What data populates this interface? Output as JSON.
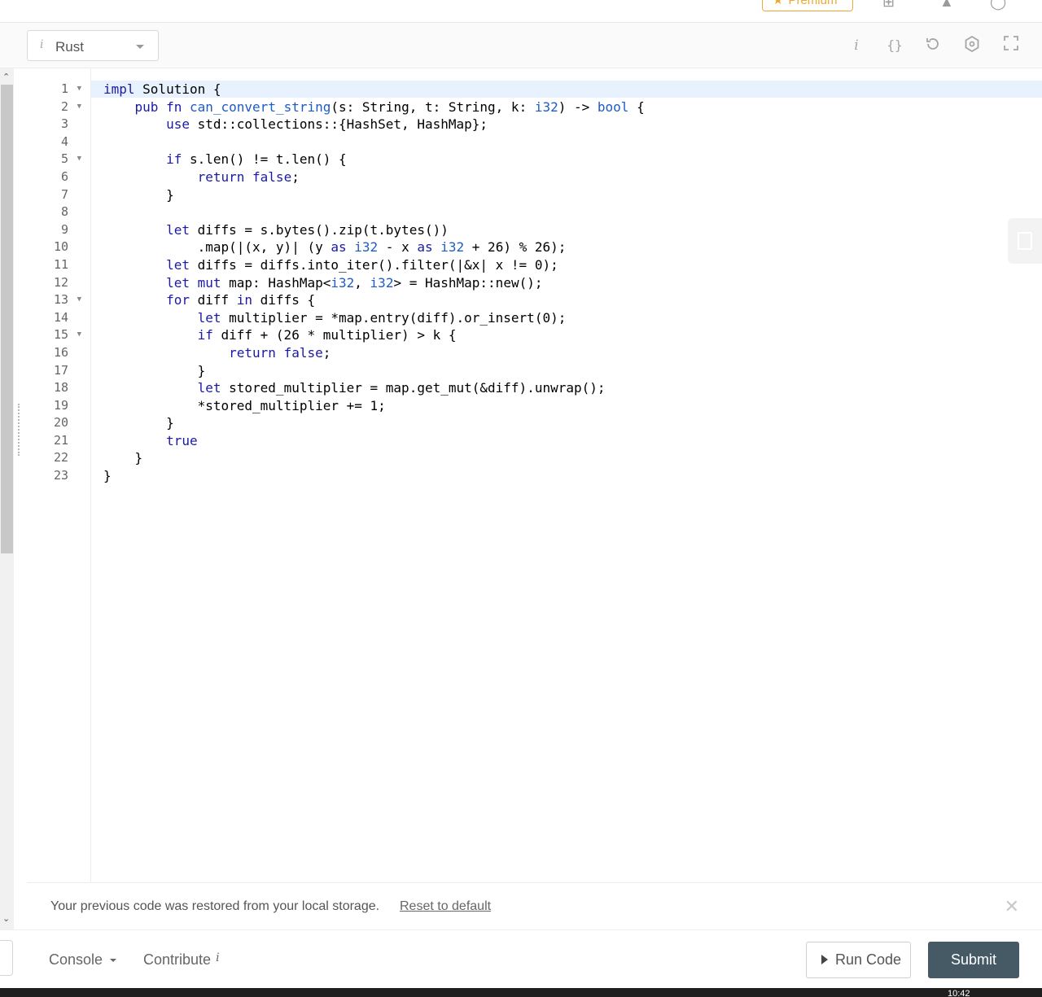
{
  "topbar": {
    "premium_label": "Premium",
    "icons": [
      "new-playground-icon",
      "bell-icon",
      "user-avatar-icon"
    ]
  },
  "toolbar": {
    "language": "Rust",
    "language_info": "i",
    "icons": [
      "info-icon",
      "braces-icon",
      "reset-icon",
      "settings-icon",
      "fullscreen-icon"
    ]
  },
  "editor": {
    "lines": [
      "impl Solution {",
      "    pub fn can_convert_string(s: String, t: String, k: i32) -> bool {",
      "        use std::collections::{HashSet, HashMap};",
      "",
      "        if s.len() != t.len() {",
      "            return false;",
      "        }",
      "",
      "        let diffs = s.bytes().zip(t.bytes())",
      "            .map(|(x, y)| (y as i32 - x as i32 + 26) % 26);",
      "        let diffs = diffs.into_iter().filter(|&x| x != 0);",
      "        let mut map: HashMap<i32, i32> = HashMap::new();",
      "        for diff in diffs {",
      "            let multiplier = *map.entry(diff).or_insert(0);",
      "            if diff + (26 * multiplier) > k {",
      "                return false;",
      "            }",
      "            let stored_multiplier = map.get_mut(&diff).unwrap();",
      "            *stored_multiplier += 1;",
      "        }",
      "        true",
      "    }",
      "}"
    ],
    "fold_lines": [
      1,
      2,
      5,
      13,
      15
    ]
  },
  "notice": {
    "message": "Your previous code was restored from your local storage.",
    "reset_link": "Reset to default"
  },
  "bottom": {
    "console_label": "Console",
    "contribute_label": "Contribute",
    "contribute_info": "i",
    "run_label": "Run Code",
    "submit_label": "Submit"
  },
  "taskbar": {
    "time": "10:42"
  },
  "colors": {
    "keyword": "#1a1aa6",
    "function": "#1e5bc6",
    "submit_bg": "#455a64",
    "premium": "#f0a732",
    "active_line": "#e8f2ff"
  }
}
